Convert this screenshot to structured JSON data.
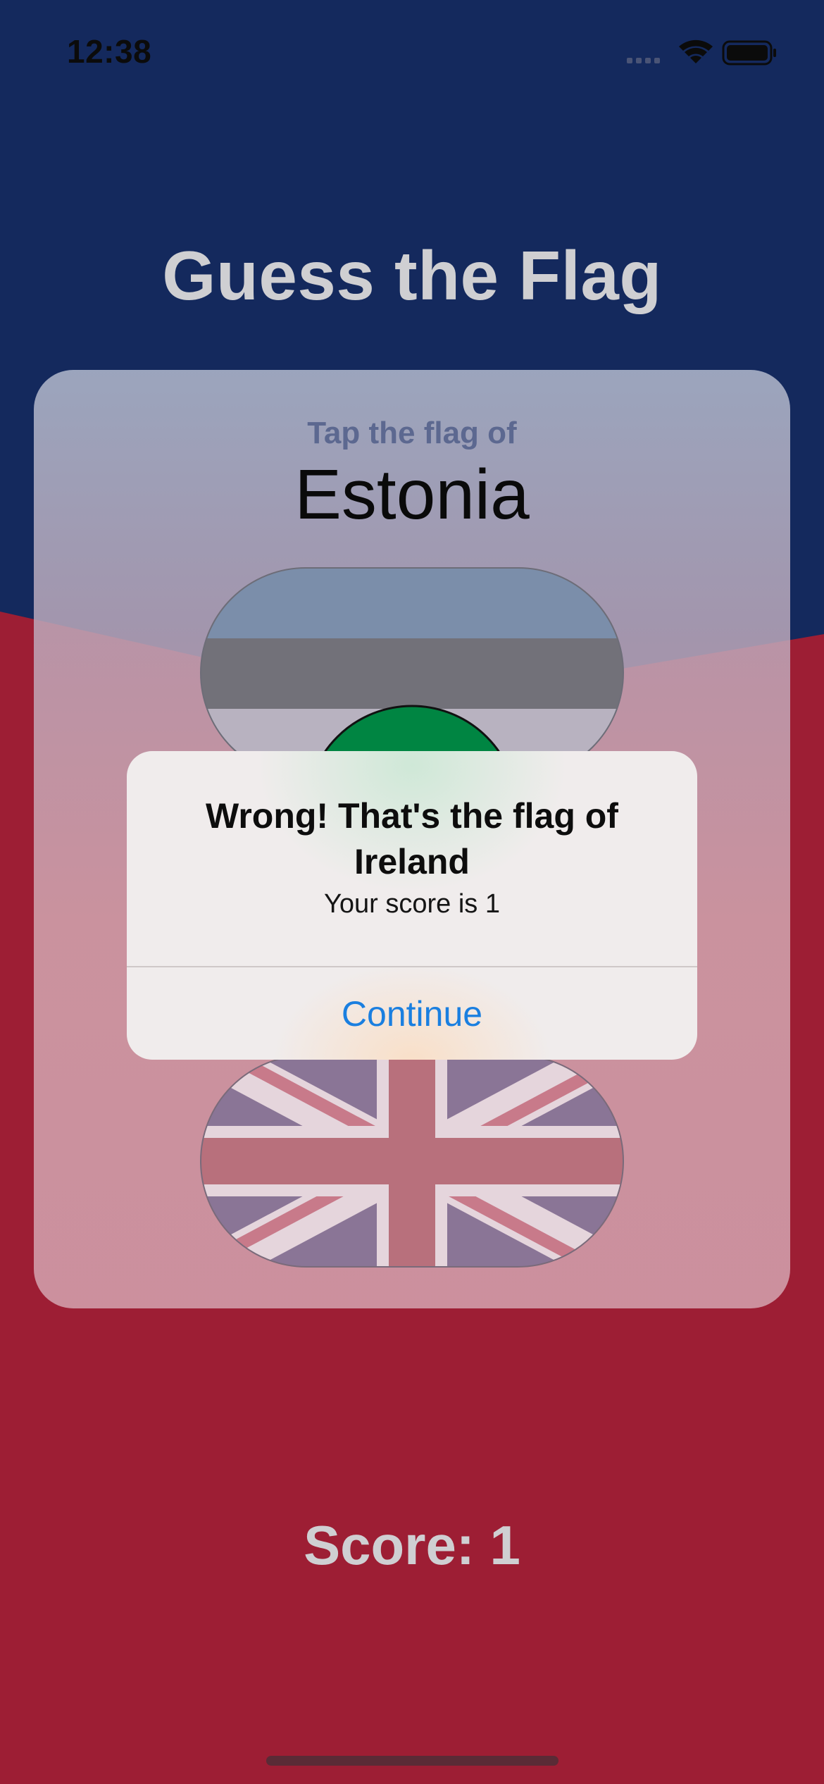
{
  "status_bar": {
    "time": "12:38"
  },
  "app": {
    "title": "Guess the Flag",
    "score_text": "Score: 1"
  },
  "question_card": {
    "subtitle": "Tap the flag of",
    "country": "Estonia",
    "flags": [
      {
        "country": "Estonia",
        "icon": "flag-estonia"
      },
      {
        "country": "Ireland",
        "icon": "flag-ireland"
      },
      {
        "country": "UK",
        "icon": "flag-uk"
      }
    ]
  },
  "alert": {
    "title": "Wrong! That's the flag of Ireland",
    "message": "Your score is 1",
    "button_label": "Continue"
  },
  "colors": {
    "background_top": "#14295d",
    "background_bottom": "#9d1e34",
    "accent_blue": "#1a7fe0"
  }
}
